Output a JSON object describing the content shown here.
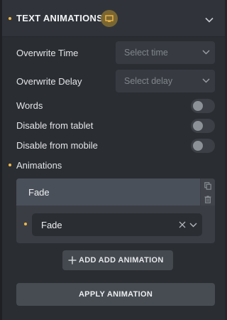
{
  "section": {
    "title": "TEXT ANIMATIONS",
    "badge_icon": "responsive-screen-icon",
    "collapse_icon": "chevron-down-icon",
    "accent_color": "#f0b849"
  },
  "fields": {
    "overwrite_time": {
      "label": "Overwrite Time",
      "placeholder": "Select time"
    },
    "overwrite_delay": {
      "label": "Overwrite Delay",
      "placeholder": "Select delay"
    }
  },
  "toggles": [
    {
      "label": "Words",
      "on": false
    },
    {
      "label": "Disable from tablet",
      "on": false
    },
    {
      "label": "Disable from mobile",
      "on": false
    }
  ],
  "animations": {
    "label": "Animations",
    "items": [
      {
        "tab_label": "Fade",
        "select_value": "Fade"
      }
    ],
    "duplicate_icon": "duplicate-icon",
    "delete_icon": "trash-icon"
  },
  "buttons": {
    "add_label": "ADD ADD ANIMATION",
    "apply_label": "APPLY ANIMATION"
  }
}
